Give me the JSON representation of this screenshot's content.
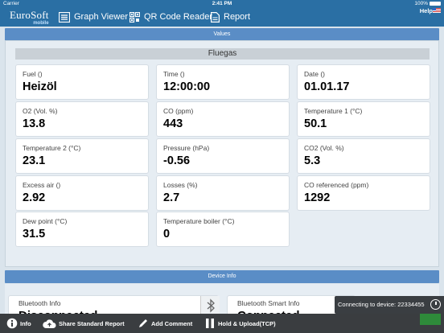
{
  "statusbar": {
    "carrier": "Carrier",
    "time": "2:41 PM",
    "battery": "100%"
  },
  "navbar": {
    "logo_top": "EuroSoft",
    "logo_sub": "mobile",
    "graph_viewer": "Graph Viewer",
    "qr_reader": "QR Code Reader",
    "report": "Report",
    "help": "Help"
  },
  "values": {
    "section_title": "Values",
    "group_title": "Fluegas",
    "cards": [
      {
        "label": "Fuel ()",
        "value": "Heizöl"
      },
      {
        "label": "Time ()",
        "value": "12:00:00"
      },
      {
        "label": "Date ()",
        "value": "01.01.17"
      },
      {
        "label": "O2 (Vol. %)",
        "value": "13.8"
      },
      {
        "label": "CO (ppm)",
        "value": "443"
      },
      {
        "label": "Temperature 1 (°C)",
        "value": "50.1"
      },
      {
        "label": "Temperature 2 (°C)",
        "value": "23.1"
      },
      {
        "label": "Pressure (hPa)",
        "value": "-0.56"
      },
      {
        "label": "CO2 (Vol. %)",
        "value": "5.3"
      },
      {
        "label": "Excess air ()",
        "value": "2.92"
      },
      {
        "label": "Losses (%)",
        "value": "2.7"
      },
      {
        "label": "CO referenced (ppm)",
        "value": "1292"
      },
      {
        "label": "Dew point (°C)",
        "value": "31.5"
      },
      {
        "label": "Temperature boiler (°C)",
        "value": "0"
      }
    ]
  },
  "device": {
    "section_title": "Device Info",
    "bluetooth_label": "Bluetooth Info",
    "bluetooth_value": "Disconnected",
    "smart_label": "Bluetooth Smart Info",
    "smart_value": "Connected"
  },
  "toast": {
    "text": "Connecting to device: 22334455"
  },
  "bottombar": {
    "info": "Info",
    "share": "Share Standard Report",
    "comment": "Add Comment",
    "hold": "Hold & Upload(TCP)"
  },
  "colors": {
    "primary": "#2a6fa4",
    "section": "#5a8dc6",
    "bottom": "#3a3d40"
  }
}
